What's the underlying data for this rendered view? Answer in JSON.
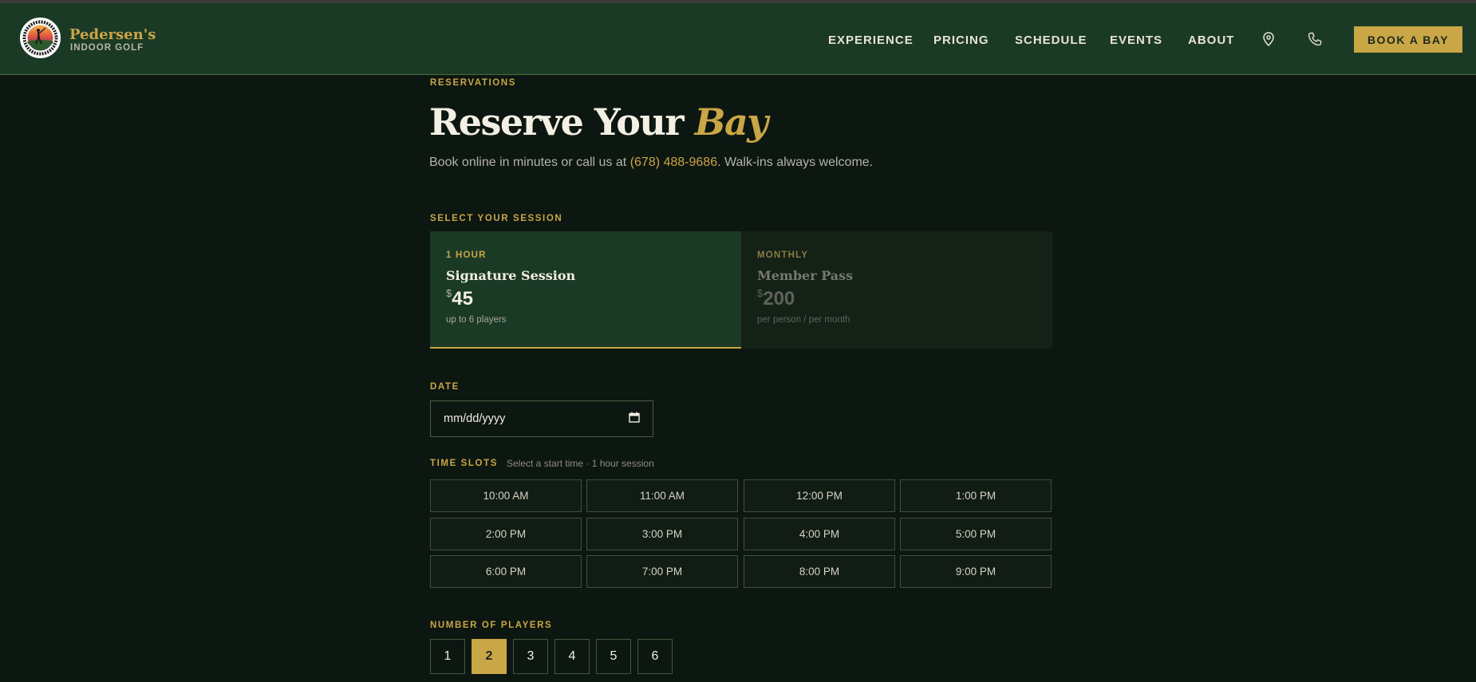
{
  "brand": {
    "name": "Pedersen's",
    "tagline": "INDOOR GOLF"
  },
  "nav": {
    "links": [
      "EXPERIENCE",
      "PRICING",
      "SCHEDULE",
      "EVENTS",
      "ABOUT"
    ],
    "book_label": "BOOK A BAY",
    "icons": [
      "map-pin-icon",
      "phone-icon"
    ]
  },
  "hero": {
    "eyebrow": "RESERVATIONS",
    "title_main": "Reserve Your",
    "title_accent": "Bay",
    "subtitle_before": "Book online in minutes or call us at ",
    "phone": "(678) 488-9686",
    "subtitle_after": ". Walk-ins always welcome."
  },
  "session": {
    "heading": "SELECT YOUR SESSION",
    "options": [
      {
        "label": "1 HOUR",
        "name": "Signature Session",
        "currency": "$",
        "price": "45",
        "note": "up to 6 players",
        "selected": true
      },
      {
        "label": "MONTHLY",
        "name": "Member Pass",
        "currency": "$",
        "price": "200",
        "note": "per person / per month",
        "selected": false
      }
    ]
  },
  "date": {
    "label": "DATE",
    "placeholder": "mm/dd/yyyy"
  },
  "timeslots": {
    "label": "TIME SLOTS",
    "hint": "Select a start time · 1 hour session",
    "slots": [
      "10:00 AM",
      "11:00 AM",
      "12:00 PM",
      "1:00 PM",
      "2:00 PM",
      "3:00 PM",
      "4:00 PM",
      "5:00 PM",
      "6:00 PM",
      "7:00 PM",
      "8:00 PM",
      "9:00 PM"
    ]
  },
  "players": {
    "label": "NUMBER OF PLAYERS",
    "options": [
      "1",
      "2",
      "3",
      "4",
      "5",
      "6"
    ],
    "selected": "2"
  },
  "colors": {
    "accent": "#c9a646",
    "nav_bg": "#1b3a26",
    "page_bg": "#0d1711"
  }
}
